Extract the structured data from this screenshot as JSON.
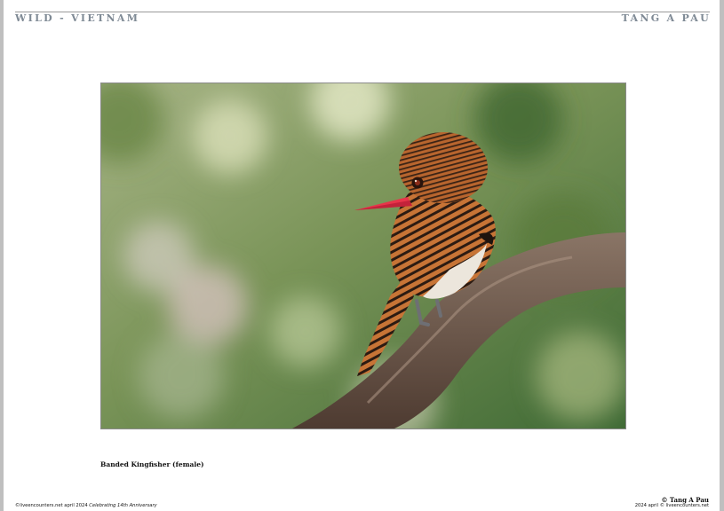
{
  "header": {
    "left_title": "WILD - VIETNAM",
    "right_title": "TANG A PAU"
  },
  "photo": {
    "subject": "bird-on-branch"
  },
  "caption": "Banded Kingfisher (female)",
  "footer": {
    "left_text": "©liveencounters.net april 2024",
    "left_italic": "Celebrating 14th Anniversary",
    "credit_name": "© Tang A Pau",
    "credit_copyright": "2024 april © liveencounters.net"
  },
  "colors": {
    "header_text": "#7f8a95",
    "bird_beak": "#e8344a",
    "bird_plumage": "#b5612c",
    "background_green": "#6f8a4e"
  }
}
